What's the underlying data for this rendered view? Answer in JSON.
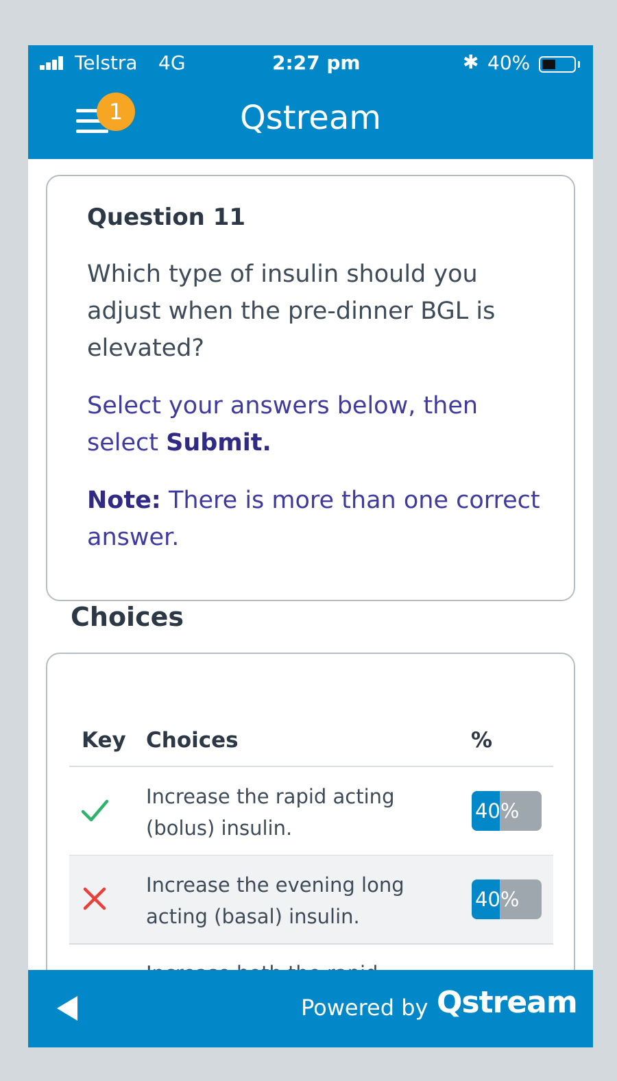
{
  "status_bar": {
    "carrier": "Telstra",
    "network": "4G",
    "time": "2:27 pm",
    "battery_percent": "40%",
    "battery_level": 0.4
  },
  "header": {
    "menu_badge": "1",
    "title": "Qstream"
  },
  "question": {
    "title": "Question 11",
    "text": "Which type of insulin should you adjust when the pre-dinner BGL is elevated?",
    "instruction_prefix": "Select your answers below, then select ",
    "instruction_bold": "Submit.",
    "note_bold": "Note:",
    "note_text": " There is more than one correct answer."
  },
  "choices": {
    "heading": "Choices",
    "columns": {
      "key": "Key",
      "choices": "Choices",
      "percent": "%"
    },
    "rows": [
      {
        "key": "correct",
        "text": "Increase the rapid acting (bolus) insulin.",
        "percent_label": "40%",
        "percent": 40
      },
      {
        "key": "incorrect",
        "text": "Increase the evening long acting (basal) insulin.",
        "percent_label": "40%",
        "percent": 40
      },
      {
        "text": "Increase both the rapid"
      }
    ]
  },
  "footer": {
    "powered_by": "Powered by",
    "brand": "Qstream"
  },
  "colors": {
    "brand_blue": "#0288c8",
    "badge_orange": "#f6a623",
    "instruction_purple": "#3f3a9e",
    "correct_green": "#2db36b",
    "incorrect_red": "#e8413c"
  }
}
